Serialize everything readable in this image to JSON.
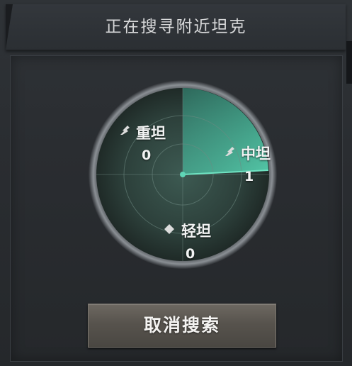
{
  "dialog": {
    "title": "正在搜寻附近坦克",
    "cancel_label": "取消搜索"
  },
  "radar": {
    "heavy": {
      "icon": "heavy-tank-icon",
      "label": "重坦",
      "count": "0"
    },
    "medium": {
      "icon": "medium-tank-icon",
      "label": "中坦",
      "count": "1"
    },
    "light": {
      "icon": "light-tank-icon",
      "label": "轻坦",
      "count": "0"
    },
    "sweep_color": "#4fc1a3"
  }
}
